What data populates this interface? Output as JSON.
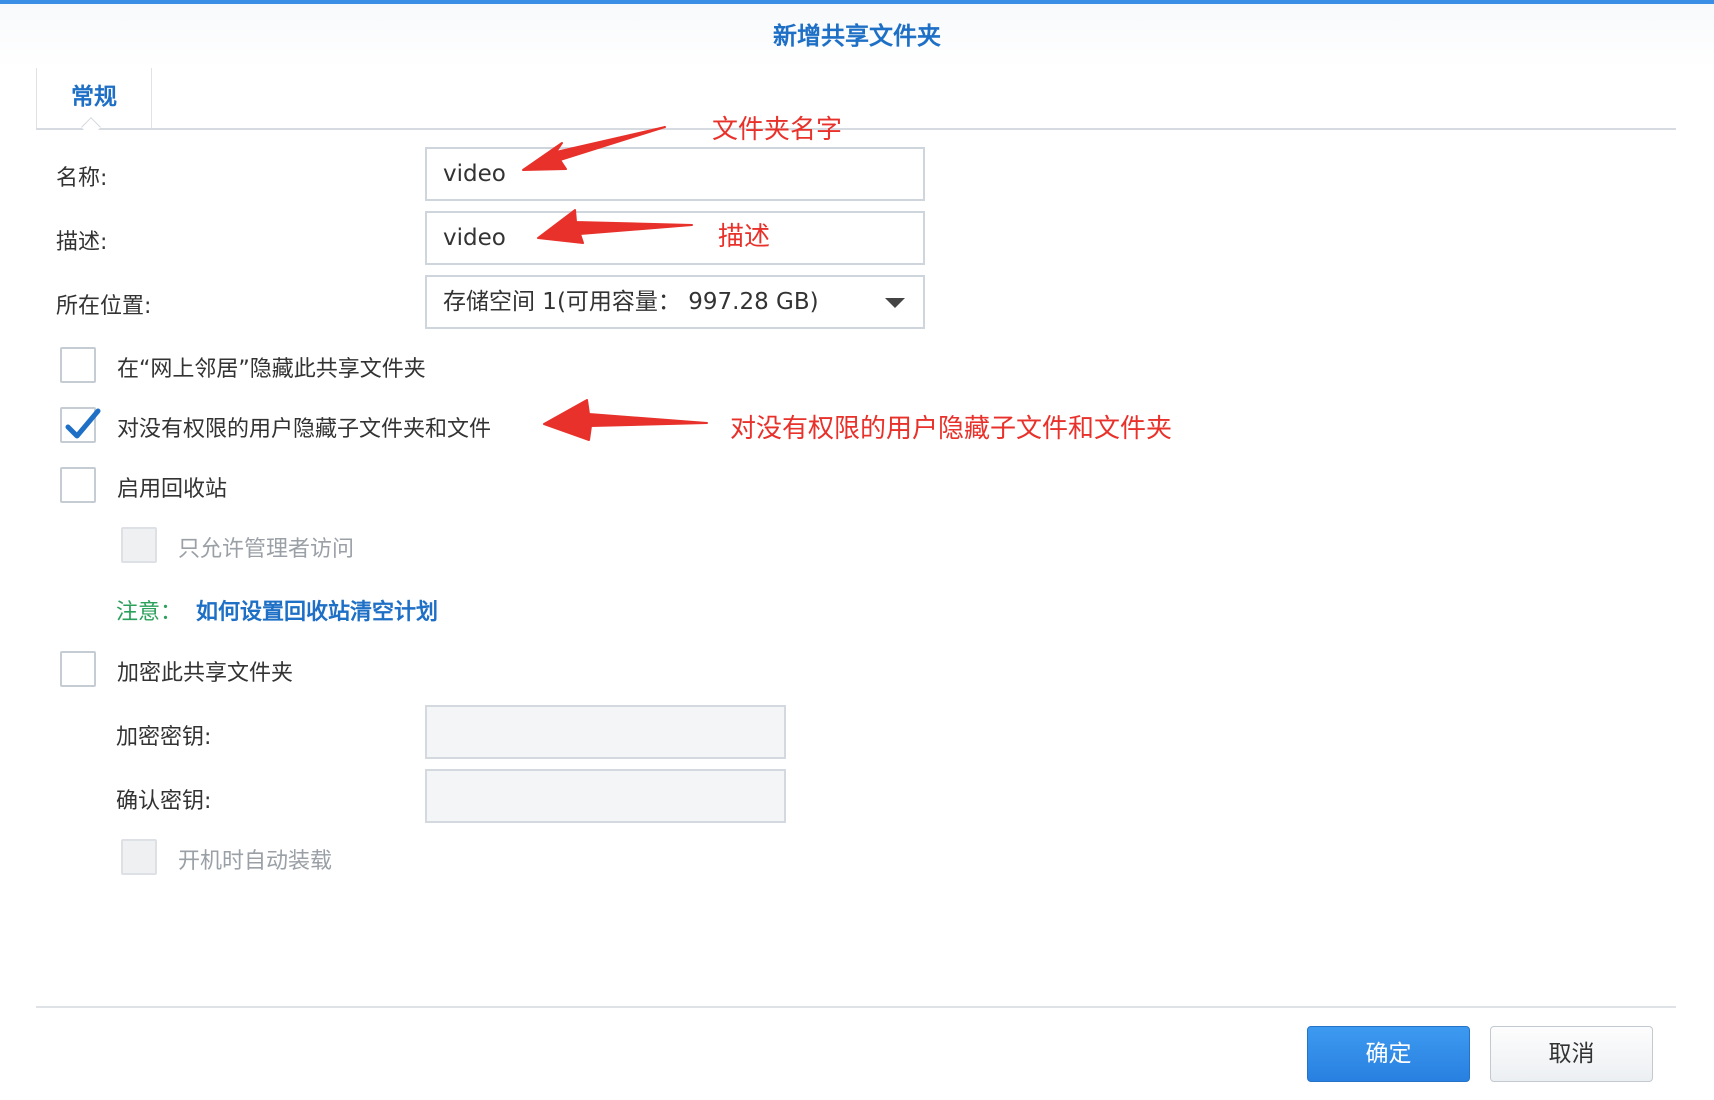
{
  "dialog": {
    "title": "新增共享文件夹",
    "tab_general": "常规"
  },
  "form": {
    "name_label": "名称:",
    "name_value": "video",
    "desc_label": "描述:",
    "desc_value": "video",
    "location_label": "所在位置:",
    "location_value": "存储空间 1(可用容量： 997.28 GB)",
    "hide_network": {
      "label": "在“网上邻居”隐藏此共享文件夹",
      "checked": false
    },
    "hide_unauthorized": {
      "label": "对没有权限的用户隐藏子文件夹和文件",
      "checked": true
    },
    "recycle_bin": {
      "label": "启用回收站",
      "checked": false
    },
    "admin_only": {
      "label": "只允许管理者访问",
      "checked": false,
      "disabled": true
    },
    "note_label": "注意：",
    "note_link": "如何设置回收站清空计划",
    "encrypt": {
      "label": "加密此共享文件夹",
      "checked": false
    },
    "encrypt_key_label": "加密密钥:",
    "confirm_key_label": "确认密钥:",
    "auto_mount": {
      "label": "开机时自动装载",
      "checked": false,
      "disabled": true
    }
  },
  "buttons": {
    "ok": "确定",
    "cancel": "取消"
  },
  "annotations": {
    "folder_name": "文件夹名字",
    "description": "描述",
    "hide_note": "对没有权限的用户隐藏子文件和文件夹"
  },
  "colors": {
    "accent": "#1e6fc6",
    "annotation": "#e8312a",
    "note": "#2aa05a"
  }
}
